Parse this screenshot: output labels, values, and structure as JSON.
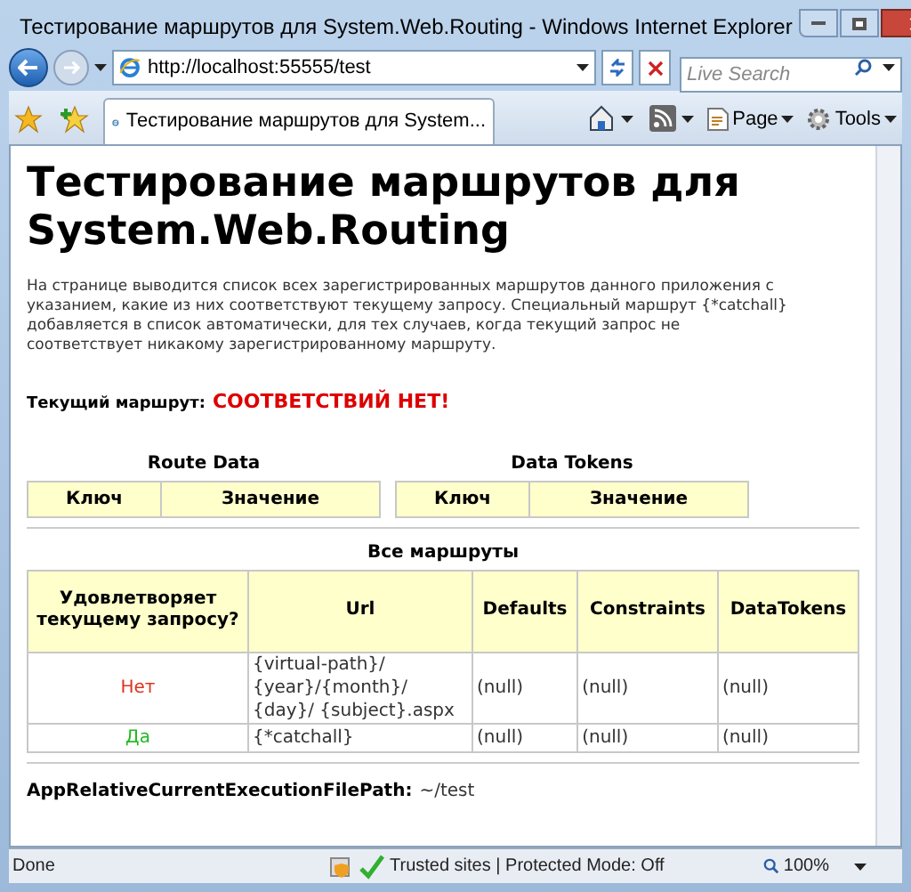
{
  "window": {
    "title": "Тестирование маршрутов для System.Web.Routing - Windows Internet Explorer"
  },
  "address_bar": {
    "url": "http://localhost:55555/test",
    "search_placeholder": "Live Search"
  },
  "tab": {
    "label": "Тестирование маршрутов для System..."
  },
  "toolbar": {
    "buttons": [
      "Page",
      "Tools"
    ]
  },
  "page": {
    "heading": "Тестирование маршрутов для System.Web.Routing",
    "description": "На странице выводится список всех зарегистрированных маршрутов данного приложения с указанием, какие из них соответствуют текущему запросу. Специальный маршрут {*catchall} добавляется в список автоматически, для тех случаев, когда текущий запрос не соответствует никакому зарегистрированному маршруту.",
    "current_route": {
      "label": "Текущий маршрут:",
      "value": "СООТВЕТСТВИЙ НЕТ!"
    },
    "small_tables": [
      {
        "title": "Route Data",
        "columns": [
          "Ключ",
          "Значение"
        ]
      },
      {
        "title": "Data Tokens",
        "columns": [
          "Ключ",
          "Значение"
        ]
      }
    ],
    "all_routes": {
      "title": "Все маршруты",
      "columns": [
        "Удовлетворяет текущему запросу?",
        "Url",
        "Defaults",
        "Constraints",
        "DataTokens"
      ],
      "rows": [
        {
          "matches": false,
          "match_text": "Нет",
          "url": "{virtual-path}/ {year}/{month}/ {day}/ {subject}.aspx",
          "defaults": "(null)",
          "constraints": "(null)",
          "data_tokens": "(null)"
        },
        {
          "matches": true,
          "match_text": "Да",
          "url": "{*catchall}",
          "defaults": "(null)",
          "constraints": "(null)",
          "data_tokens": "(null)"
        }
      ]
    },
    "footer": {
      "label": "AppRelativeCurrentExecutionFilePath:",
      "value": "~/test"
    }
  },
  "status_bar": {
    "status": "Done",
    "zone": "Trusted sites | Protected Mode: Off",
    "zoom": "100%"
  }
}
